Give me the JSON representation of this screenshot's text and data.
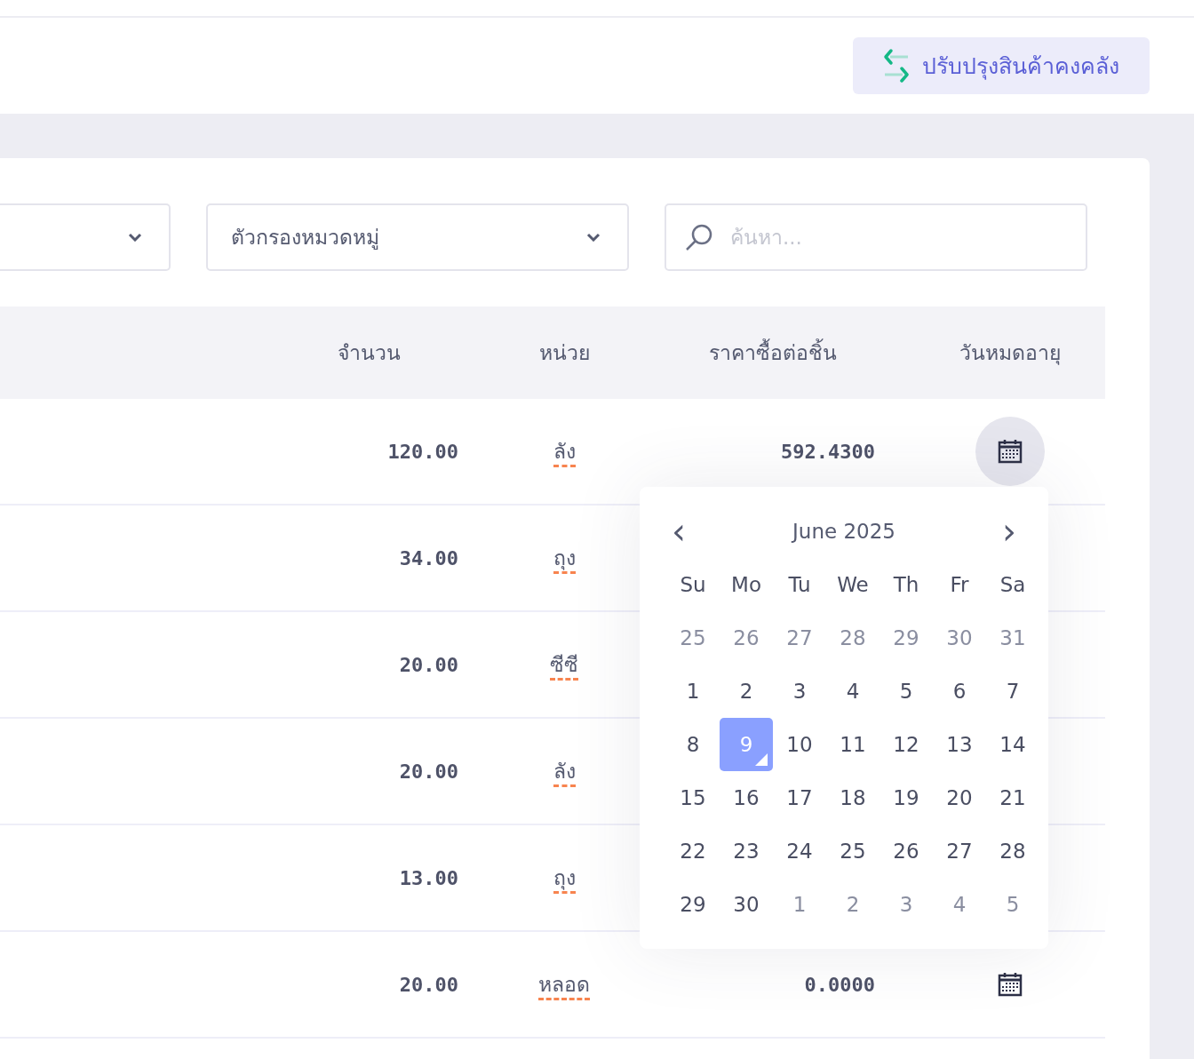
{
  "header": {
    "adjust_button": "ปรับปรุงสินค้าคงคลัง"
  },
  "filters": {
    "category": {
      "placeholder": "ตัวกรองหมวดหมู่"
    },
    "search": {
      "placeholder": "ค้นหา..."
    }
  },
  "table": {
    "columns": [
      "จำนวน",
      "หน่วย",
      "ราคาซื้อต่อชิ้น",
      "วันหมดอายุ"
    ],
    "rows": [
      {
        "qty": "120.00",
        "unit": "ลัง",
        "price": "592.4300",
        "calendar": {
          "open": true
        }
      },
      {
        "qty": "34.00",
        "unit": "ถุง"
      },
      {
        "qty": "20.00",
        "unit": "ซีซี"
      },
      {
        "qty": "20.00",
        "unit": "ลัง"
      },
      {
        "qty": "13.00",
        "unit": "ถุง"
      },
      {
        "qty": "20.00",
        "unit": "หลอด",
        "price": "0.0000",
        "calendar": {
          "open": false
        }
      }
    ]
  },
  "datepicker": {
    "prev": "‹",
    "next": "›",
    "title": "June 2025",
    "weekdays": [
      "Su",
      "Mo",
      "Tu",
      "We",
      "Th",
      "Fr",
      "Sa"
    ],
    "weeks": [
      [
        {
          "day": "25",
          "outside": true,
          "selected": false
        },
        {
          "day": "26",
          "outside": true,
          "selected": false
        },
        {
          "day": "27",
          "outside": true,
          "selected": false
        },
        {
          "day": "28",
          "outside": true,
          "selected": false
        },
        {
          "day": "29",
          "outside": true,
          "selected": false
        },
        {
          "day": "30",
          "outside": true,
          "selected": false
        },
        {
          "day": "31",
          "outside": true,
          "selected": false
        }
      ],
      [
        {
          "day": "1",
          "outside": false,
          "selected": false
        },
        {
          "day": "2",
          "outside": false,
          "selected": false
        },
        {
          "day": "3",
          "outside": false,
          "selected": false
        },
        {
          "day": "4",
          "outside": false,
          "selected": false
        },
        {
          "day": "5",
          "outside": false,
          "selected": false
        },
        {
          "day": "6",
          "outside": false,
          "selected": false
        },
        {
          "day": "7",
          "outside": false,
          "selected": false
        }
      ],
      [
        {
          "day": "8",
          "outside": false,
          "selected": false
        },
        {
          "day": "9",
          "outside": false,
          "selected": true
        },
        {
          "day": "10",
          "outside": false,
          "selected": false
        },
        {
          "day": "11",
          "outside": false,
          "selected": false
        },
        {
          "day": "12",
          "outside": false,
          "selected": false
        },
        {
          "day": "13",
          "outside": false,
          "selected": false
        },
        {
          "day": "14",
          "outside": false,
          "selected": false
        }
      ],
      [
        {
          "day": "15",
          "outside": false,
          "selected": false
        },
        {
          "day": "16",
          "outside": false,
          "selected": false
        },
        {
          "day": "17",
          "outside": false,
          "selected": false
        },
        {
          "day": "18",
          "outside": false,
          "selected": false
        },
        {
          "day": "19",
          "outside": false,
          "selected": false
        },
        {
          "day": "20",
          "outside": false,
          "selected": false
        },
        {
          "day": "21",
          "outside": false,
          "selected": false
        }
      ],
      [
        {
          "day": "22",
          "outside": false,
          "selected": false
        },
        {
          "day": "23",
          "outside": false,
          "selected": false
        },
        {
          "day": "24",
          "outside": false,
          "selected": false
        },
        {
          "day": "25",
          "outside": false,
          "selected": false
        },
        {
          "day": "26",
          "outside": false,
          "selected": false
        },
        {
          "day": "27",
          "outside": false,
          "selected": false
        },
        {
          "day": "28",
          "outside": false,
          "selected": false
        }
      ],
      [
        {
          "day": "29",
          "outside": false,
          "selected": false
        },
        {
          "day": "30",
          "outside": false,
          "selected": false
        },
        {
          "day": "1",
          "outside": true,
          "selected": false
        },
        {
          "day": "2",
          "outside": true,
          "selected": false
        },
        {
          "day": "3",
          "outside": true,
          "selected": false
        },
        {
          "day": "4",
          "outside": true,
          "selected": false
        },
        {
          "day": "5",
          "outside": true,
          "selected": false
        }
      ]
    ]
  }
}
